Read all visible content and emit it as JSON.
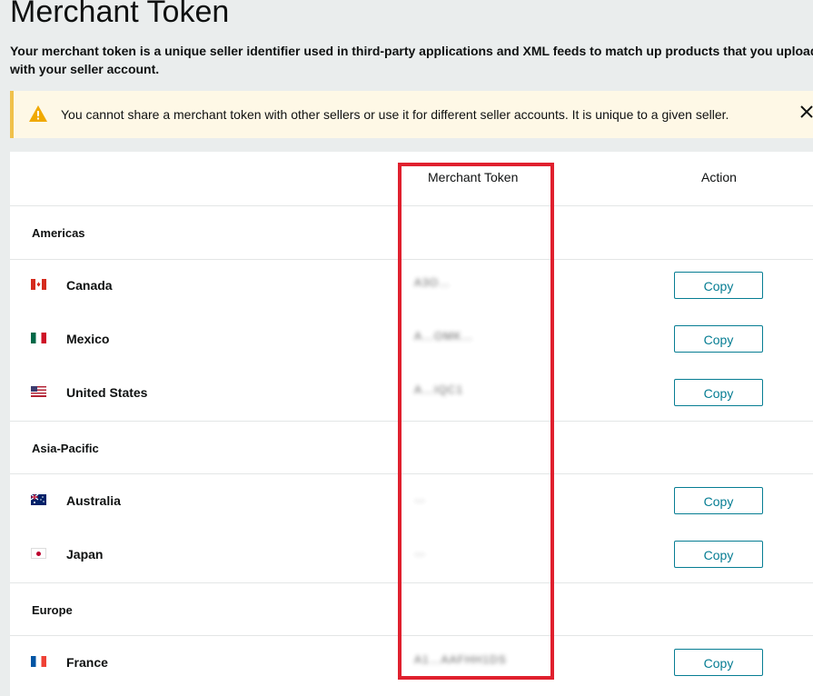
{
  "page": {
    "title": "Merchant Token",
    "description": "Your merchant token is a unique seller identifier used in third-party applications and XML feeds to match up products that you upload with your seller account."
  },
  "alert": {
    "text": "You cannot share a merchant token with other sellers or use it for different seller accounts. It is unique to a given seller.",
    "icon": "warning-icon",
    "close_icon": "close-icon",
    "accent_color": "#f0c14b"
  },
  "table": {
    "headers": {
      "token": "Merchant Token",
      "action": "Action"
    },
    "regions": [
      {
        "name": "Americas",
        "countries": [
          {
            "name": "Canada",
            "token": "A3O…",
            "copy": "Copy"
          },
          {
            "name": "Mexico",
            "token": "A…OMK…",
            "copy": "Copy"
          },
          {
            "name": "United States",
            "token": "A…IQC1",
            "copy": "Copy"
          }
        ]
      },
      {
        "name": "Asia-Pacific",
        "countries": [
          {
            "name": "Australia",
            "token": "…",
            "copy": "Copy"
          },
          {
            "name": "Japan",
            "token": "…",
            "copy": "Copy"
          }
        ]
      },
      {
        "name": "Europe",
        "countries": [
          {
            "name": "France",
            "token": "A1…AAFHH1DS",
            "copy": "Copy"
          }
        ]
      }
    ]
  },
  "colors": {
    "highlight": "#e0202e",
    "link": "#067d93"
  }
}
